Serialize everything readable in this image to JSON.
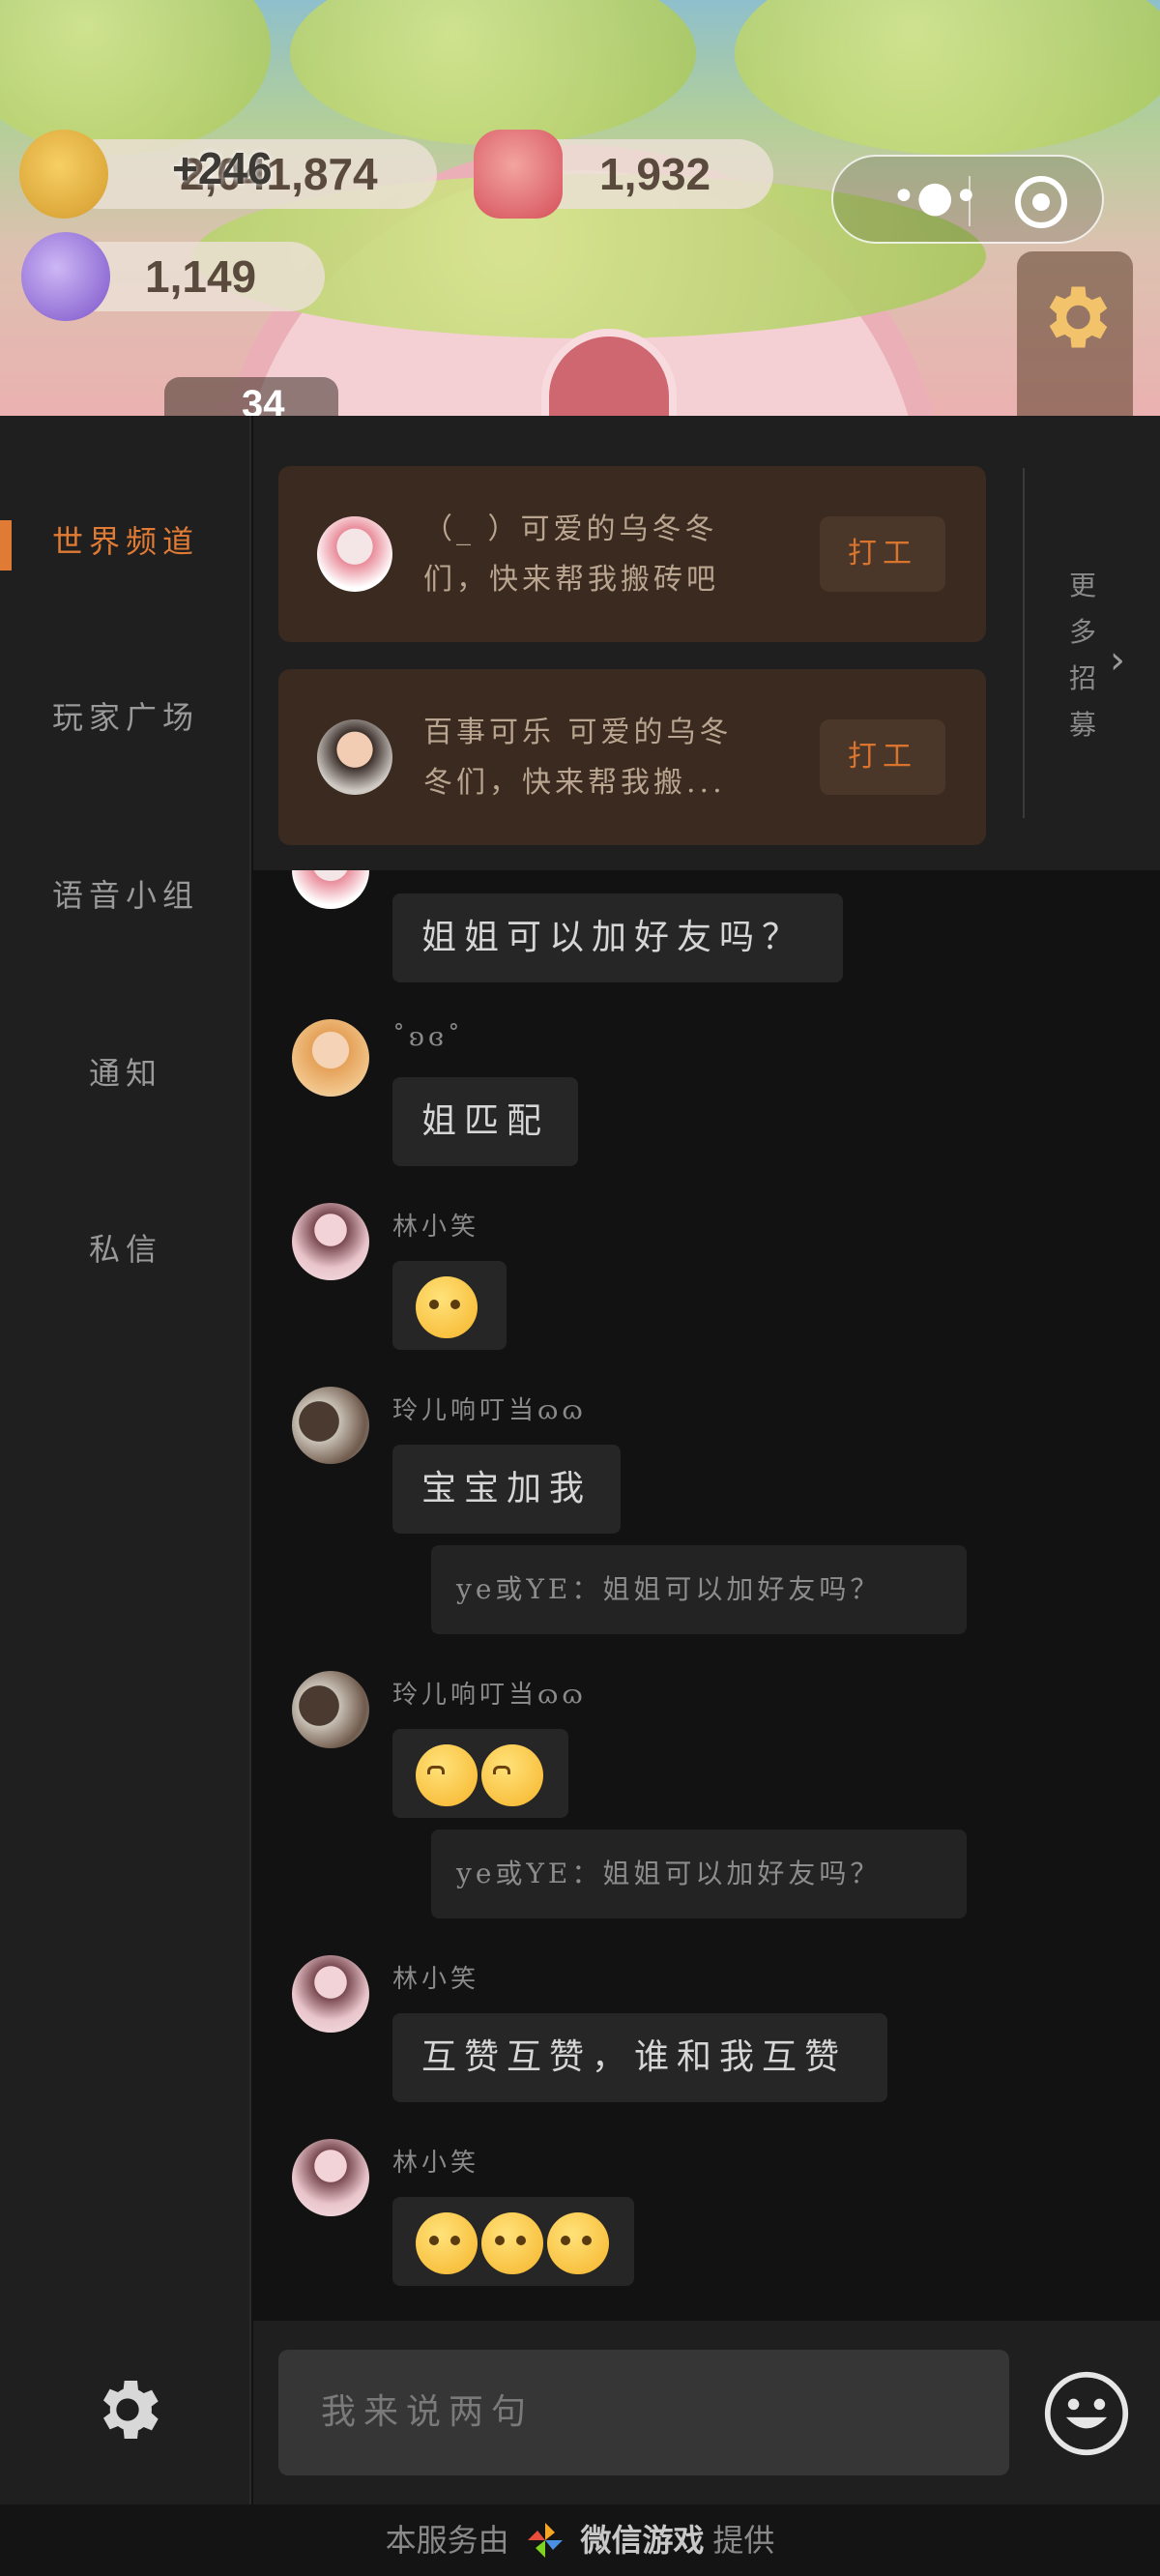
{
  "game": {
    "resources": {
      "coins": "2,041,874",
      "coins_delta": "+246",
      "gems": "1,932",
      "crystals": "1,149",
      "level": "34"
    }
  },
  "sidebar": {
    "items": [
      {
        "label": "世界频道",
        "active": true
      },
      {
        "label": "玩家广场"
      },
      {
        "label": "语音小组"
      },
      {
        "label": "通知"
      },
      {
        "label": "私信"
      }
    ]
  },
  "recruit": {
    "cards": [
      {
        "text": "（_ ）可爱的乌冬冬们，快来帮我搬砖吧",
        "button": "打工"
      },
      {
        "text": "百事可乐 可爱的乌冬冬们，快来帮我搬...",
        "button": "打工"
      }
    ],
    "more": "更多招募"
  },
  "chat": {
    "messages": [
      {
        "name": "",
        "text": "姐姐可以加好友吗？"
      },
      {
        "name": "˚ʚɞ˚",
        "text": "姐匹配"
      },
      {
        "name": "林小笑",
        "emoji": [
          "pointing-eye"
        ]
      },
      {
        "name": "玲儿响叮当ɷɷ",
        "text": "宝宝加我",
        "quote": "ye或YE：姐姐可以加好友吗？"
      },
      {
        "name": "玲儿响叮当ɷɷ",
        "emoji": [
          "kiss",
          "kiss"
        ],
        "quote": "ye或YE：姐姐可以加好友吗？"
      },
      {
        "name": "林小笑",
        "text": "互赞互赞，谁和我互赞"
      },
      {
        "name": "林小笑",
        "emoji": [
          "pointing-eye",
          "pointing-eye",
          "pointing-eye"
        ]
      }
    ]
  },
  "input": {
    "placeholder": "我来说两句"
  },
  "footer": {
    "prefix": "本服务由",
    "brand": "微信游戏",
    "suffix": "提供"
  },
  "colors": {
    "accent": "#e07b36",
    "card_bg": "#3a2a1f",
    "chat_bg": "#121212"
  }
}
